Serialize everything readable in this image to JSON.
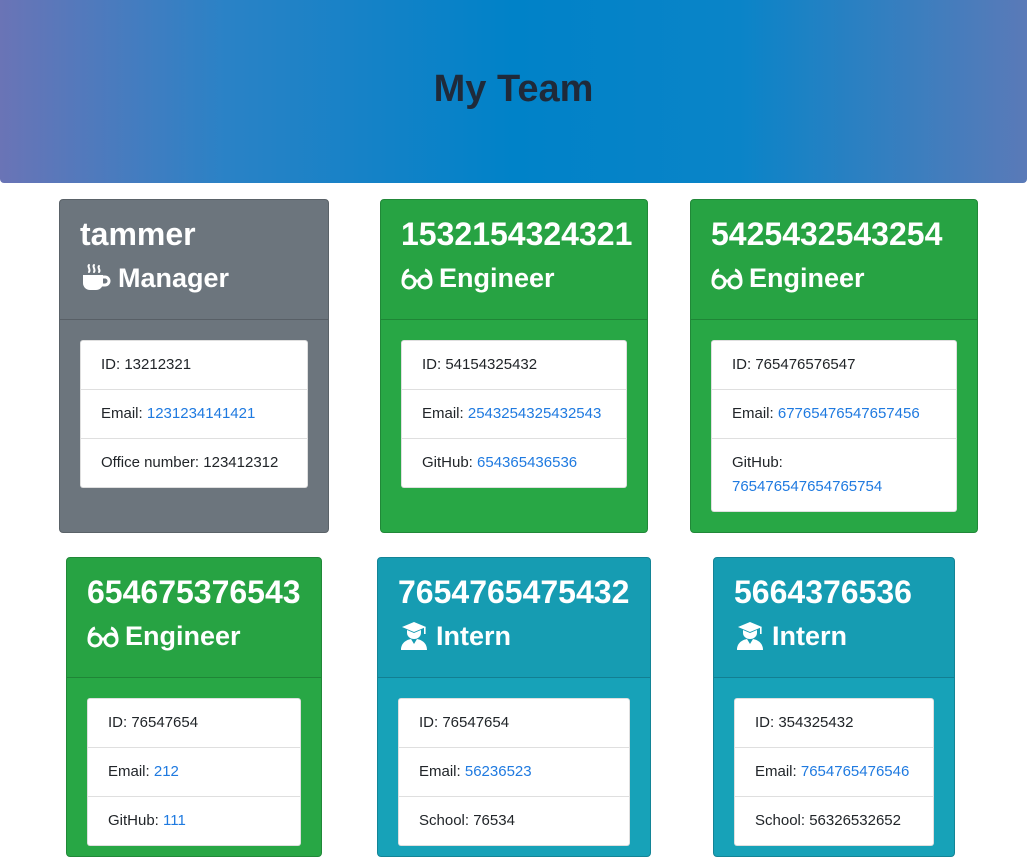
{
  "header": {
    "title": "My Team"
  },
  "cards": [
    {
      "name": "tammer",
      "role": "Manager",
      "role_icon": "coffee-icon",
      "color": "#6c757d",
      "id_label": "ID:",
      "id": "13212321",
      "email_label": "Email:",
      "email": "1231234141421",
      "extra_label": "Office number:",
      "extra": "123412312"
    },
    {
      "name": "1532154324321",
      "role": "Engineer",
      "role_icon": "glasses-icon",
      "color": "#28a745",
      "id_label": "ID:",
      "id": "54154325432",
      "email_label": "Email:",
      "email": "2543254325432543",
      "extra_label": "GitHub:",
      "extra": "654365436536"
    },
    {
      "name": "5425432543254",
      "role": "Engineer",
      "role_icon": "glasses-icon",
      "color": "#28a745",
      "id_label": "ID:",
      "id": "765476576547",
      "email_label": "Email:",
      "email": "67765476547657456",
      "extra_label": "GitHub:",
      "extra": "765476547654765754"
    },
    {
      "name": "654675376543",
      "role": "Engineer",
      "role_icon": "glasses-icon",
      "color": "#28a745",
      "id_label": "ID:",
      "id": "76547654",
      "email_label": "Email:",
      "email": "212",
      "extra_label": "GitHub:",
      "extra": "111"
    },
    {
      "name": "7654765475432",
      "role": "Intern",
      "role_icon": "graduate-icon",
      "color": "#17a2b8",
      "id_label": "ID:",
      "id": "76547654",
      "email_label": "Email:",
      "email": "56236523",
      "extra_label": "School:",
      "extra": "76534"
    },
    {
      "name": "5664376536",
      "role": "Intern",
      "role_icon": "graduate-icon",
      "color": "#17a2b8",
      "id_label": "ID:",
      "id": "354325432",
      "email_label": "Email:",
      "email": "7654765476546",
      "extra_label": "School:",
      "extra": "56326532652"
    }
  ]
}
